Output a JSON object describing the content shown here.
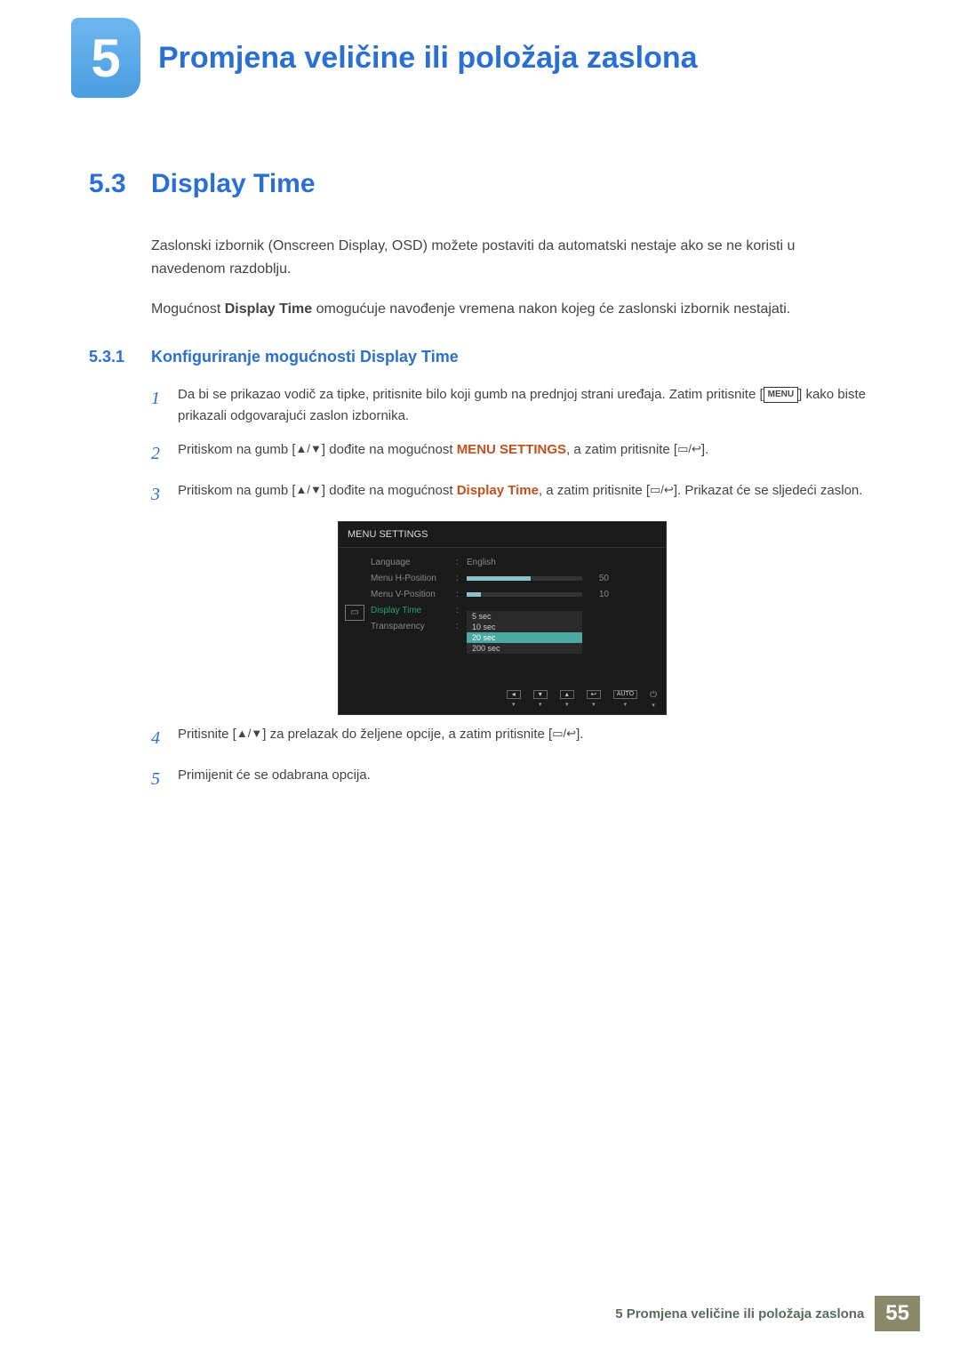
{
  "chapter": {
    "number": "5",
    "title": "Promjena veličine ili položaja zaslona"
  },
  "section": {
    "number": "5.3",
    "title": "Display Time",
    "intro1": "Zaslonski izbornik (Onscreen Display, OSD) možete postaviti da automatski nestaje ako se ne koristi u navedenom razdoblju.",
    "intro2a": "Mogućnost ",
    "intro2b": "Display Time",
    "intro2c": " omogućuje navođenje vremena nakon kojeg će zaslonski izbornik nestajati."
  },
  "subsection": {
    "number": "5.3.1",
    "title": "Konfiguriranje mogućnosti Display Time"
  },
  "steps": {
    "s1_a": "Da bi se prikazao vodič za tipke, pritisnite bilo koji gumb na prednjoj strani uređaja. Zatim pritisnite [",
    "s1_menu": "MENU",
    "s1_b": "] kako biste prikazali odgovarajući zaslon izbornika.",
    "s2_a": "Pritiskom na gumb [",
    "s2_b": "] dođite na mogućnost ",
    "s2_term": "MENU SETTINGS",
    "s2_c": ", a zatim pritisnite [",
    "s2_d": "].",
    "s3_a": "Pritiskom na gumb [",
    "s3_b": "] dođite na mogućnost ",
    "s3_term": "Display Time",
    "s3_c": ", a zatim pritisnite [",
    "s3_d": "]. Prikazat će se sljedeći zaslon.",
    "s4_a": "Pritisnite [",
    "s4_b": "] za prelazak do željene opcije, a zatim pritisnite [",
    "s4_c": "].",
    "s5": "Primijenit će se odabrana opcija."
  },
  "osd": {
    "title": "MENU SETTINGS",
    "rows": {
      "language": {
        "label": "Language",
        "value": "English"
      },
      "hpos": {
        "label": "Menu H-Position",
        "value": 50,
        "pct": 55
      },
      "vpos": {
        "label": "Menu V-Position",
        "value": 10,
        "pct": 12
      },
      "dtime": {
        "label": "Display Time"
      },
      "trans": {
        "label": "Transparency"
      }
    },
    "options": [
      "5 sec",
      "10 sec",
      "20 sec",
      "200 sec"
    ],
    "selected": "20 sec",
    "footer": {
      "auto": "AUTO"
    }
  },
  "footer": {
    "text": "5 Promjena veličine ili položaja zaslona",
    "page": "55"
  }
}
